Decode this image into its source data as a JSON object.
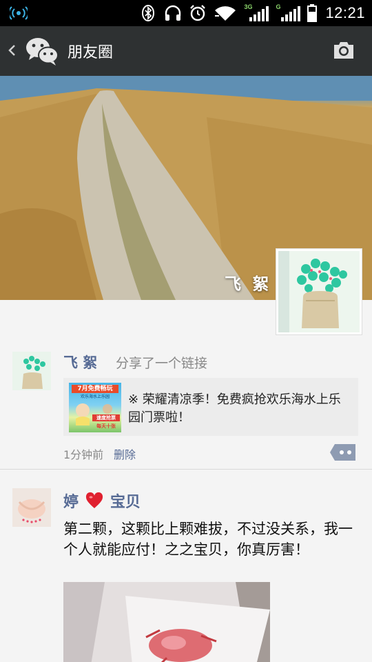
{
  "status_bar": {
    "time": "12:21",
    "sim1_label": "3G",
    "sim2_label": "G"
  },
  "header": {
    "title": "朋友圈"
  },
  "cover": {
    "name": "飞 絮"
  },
  "posts": [
    {
      "author": "飞 絮",
      "action": "分享了一个链接",
      "link_text": "※ 荣耀清凉季！免费疯抢欢乐海水上乐园门票啦！",
      "thumb_text_top": "7月免费畅玩",
      "thumb_text_mid": "欢乐海水上乐园",
      "thumb_text_bottom_1": "速度抢票",
      "thumb_text_bottom_2": "每天十张",
      "time": "1分钟前",
      "delete_label": "删除"
    },
    {
      "author_part1": "婷",
      "author_part2": "宝贝",
      "text": "第二颗，这颗比上颗难拔，不过没关系，我一个人就能应付！之之宝贝，你真厉害！"
    }
  ],
  "colors": {
    "title_bar": "#2e3132",
    "name_link": "#576b95",
    "background": "#f4f4f4"
  }
}
